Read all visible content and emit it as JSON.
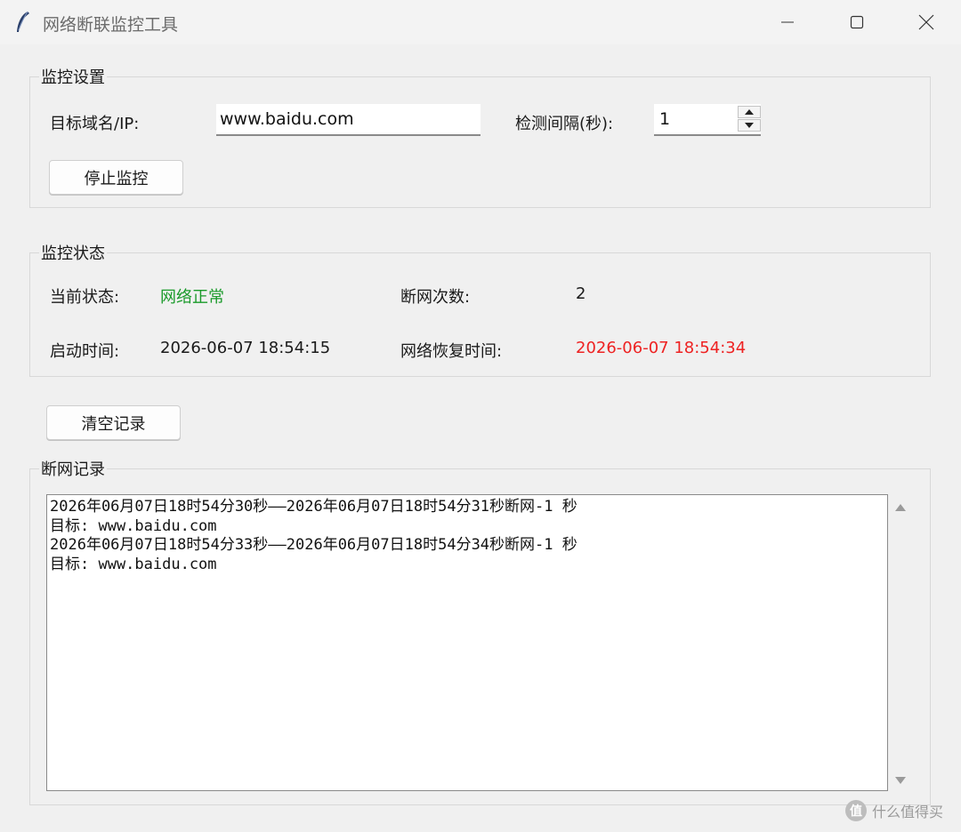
{
  "window": {
    "title": "网络断联监控工具",
    "icon": "feather-icon",
    "minimize_icon": "minimize-icon",
    "maximize_icon": "maximize-icon",
    "close_icon": "close-icon"
  },
  "settings": {
    "group_title": "监控设置",
    "target_label": "目标域名/IP:",
    "target_value": "www.baidu.com",
    "interval_label": "检测间隔(秒):",
    "interval_value": "1",
    "stop_button": "停止监控"
  },
  "status": {
    "group_title": "监控状态",
    "current_label": "当前状态:",
    "current_value": "网络正常",
    "current_color": "#1a9a2a",
    "count_label": "断网次数:",
    "count_value": "2",
    "start_label": "启动时间:",
    "start_value": "2026-06-07 18:54:15",
    "restore_label": "网络恢复时间:",
    "restore_value": "2026-06-07 18:54:34",
    "restore_color": "#ee2222"
  },
  "clear_button": "清空记录",
  "log": {
    "group_title": "断网记录",
    "lines": [
      "2026年06月07日18时54分30秒——2026年06月07日18时54分31秒断网-1 秒",
      "目标: www.baidu.com",
      "2026年06月07日18时54分33秒——2026年06月07日18时54分34秒断网-1 秒",
      "目标: www.baidu.com"
    ]
  },
  "watermark": {
    "logo_text": "值",
    "text": "什么值得买"
  }
}
